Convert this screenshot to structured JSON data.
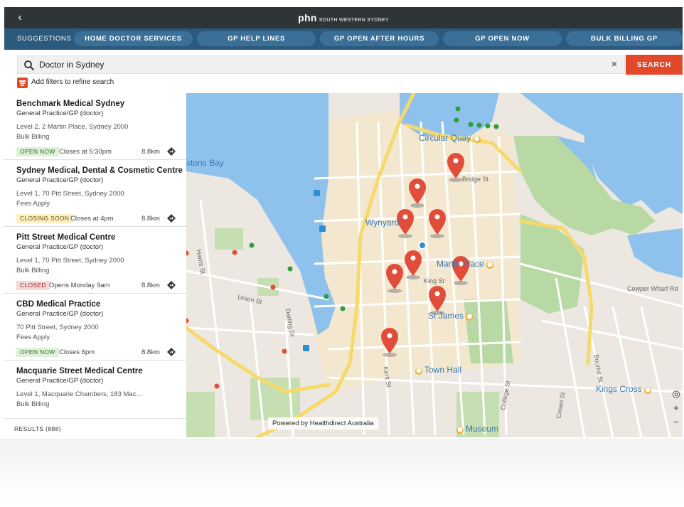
{
  "header": {
    "back_label": "‹",
    "brand_logo": "phn",
    "brand_sub": "SOUTH WESTERN SYDNEY"
  },
  "suggestions": {
    "label": "SUGGESTIONS",
    "chips": [
      "HOME DOCTOR SERVICES",
      "GP HELP LINES",
      "GP OPEN AFTER HOURS",
      "GP OPEN NOW",
      "BULK BILLING GP"
    ]
  },
  "search": {
    "value": "Doctor in Sydney",
    "clear_label": "×",
    "button_label": "SEARCH",
    "filter_label": "Add filters to refine search"
  },
  "results": [
    {
      "name": "Benchmark Medical Sydney",
      "type": "General Practice/GP (doctor)",
      "address": "Level 2, 2 Martin Place, Sydney 2000",
      "billing": "Bulk Billing",
      "status": "OPEN NOW",
      "hours": "Closes at 5:30pm",
      "distance": "8.8km"
    },
    {
      "name": "Sydney Medical, Dental & Cosmetic Centre",
      "type": "General Practice/GP (doctor)",
      "address": "Level 1, 70 Pitt Street, Sydney 2000",
      "billing": "Fees Apply",
      "status": "CLOSING SOON",
      "hours": "Closes at 4pm",
      "distance": "8.8km"
    },
    {
      "name": "Pitt Street Medical Centre",
      "type": "General Practice/GP (doctor)",
      "address": "Level 1, 70 Pitt Street, Sydney 2000",
      "billing": "Bulk Billing",
      "status": "CLOSED",
      "hours": "Opens Monday 9am",
      "distance": "8.8km"
    },
    {
      "name": "CBD Medical Practice",
      "type": "General Practice/GP (doctor)",
      "address": "70 Pitt Street, Sydney 2000",
      "billing": "Fees Apply",
      "status": "OPEN NOW",
      "hours": "Closes 6pm",
      "distance": "8.8km"
    },
    {
      "name": "Macquarie Street Medical Centre",
      "type": "General Practice/GP (doctor)",
      "address": "Level 1, Macquarie Chambers, 183 Mac...",
      "billing": "Bulk Billing",
      "status": "",
      "hours": "",
      "distance": ""
    }
  ],
  "results_count": "RESULTS (888)",
  "map": {
    "powered_by": "Powered by Healthdirect Australia",
    "labels": {
      "circular_quay": "Circular Quay",
      "wynyard": "Wynyard",
      "martin_place": "Martin Place",
      "st_james": "St James",
      "town_hall": "Town Hall",
      "kings_cross": "Kings Cross",
      "museum": "Museum",
      "stons_bay": "stons Bay",
      "bridge_st": "Bridge St",
      "king_st": "King St",
      "cowper_wharf_rd": "Cowper Wharf Rd",
      "harris_st": "Harris St",
      "bourke_st": "Bourke St",
      "college_st": "College St",
      "crown_st": "Crown St",
      "darling_dr": "Darling Dr",
      "union_st": "Union St",
      "kent_st": "Kent St"
    },
    "zoom_in": "+",
    "zoom_out": "−",
    "locate": "◎"
  },
  "colors": {
    "topbar": "#2f3437",
    "suggestions_bar": "#2b5a7d",
    "accent": "#e2492b",
    "open": "#dff0d8",
    "closing_soon": "#fcefc2",
    "closed": "#f8d7d7",
    "water": "#8ec1ec",
    "park": "#b9d9a4",
    "road_major": "#f6d96b"
  }
}
